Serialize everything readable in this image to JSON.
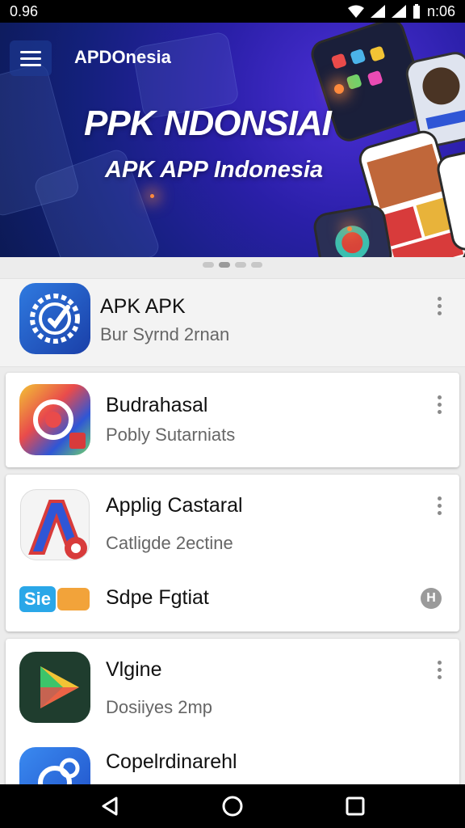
{
  "status_bar": {
    "time": "0.96",
    "clock": "n:06"
  },
  "header": {
    "brand": "APDOnesia"
  },
  "banner": {
    "title": "PPK NDONSIAI",
    "subtitle": "APK APP Indonesia"
  },
  "carousel": {
    "page_count": 4,
    "active_index": 1
  },
  "apps": [
    {
      "name": "APK APK",
      "subtitle": "Bur Syrnd 2rnan",
      "icon": "gear-clock-icon"
    },
    {
      "name": "Budrahasal",
      "subtitle": "Pobly Sutarniats",
      "icon": "colorful-swirl-icon"
    },
    {
      "name": "Applig Castaral",
      "subtitle": "Catligde 2ectine",
      "icon": "letter-a-icon"
    },
    {
      "name": "Sdpe Fgtiat",
      "subtitle": "",
      "icon": "sie-logo-icon",
      "logo_text": "Sie",
      "action_label": "H"
    },
    {
      "name": "Vlgine",
      "subtitle": "Dosiiyes 2mp",
      "icon": "play-triangle-icon"
    },
    {
      "name": "Copelrdinarehl",
      "subtitle": "",
      "icon": "blue-circle-icon"
    }
  ],
  "colors": {
    "accent": "#2f56d6",
    "hero": "#2a1fa8"
  }
}
